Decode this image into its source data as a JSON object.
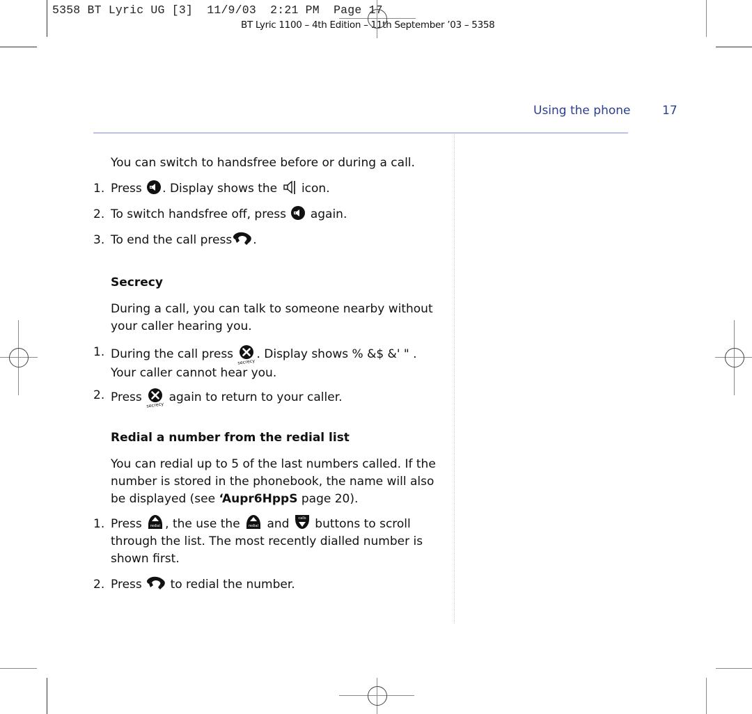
{
  "print_slug": {
    "job": "5358 BT Lyric UG [3]  11/9/03  2:21 PM  Page 17",
    "edition": "BT Lyric 1100 – 4th Edition – 11th September ’03 – 5358"
  },
  "header": {
    "section_title": "Using the phone",
    "page_number": "17",
    "accent_color": "#2a3f8f",
    "rule_color": "#bfc1e0"
  },
  "handsfree": {
    "intro": "You can switch to handsfree before or during a call.",
    "steps": [
      {
        "num": "1.",
        "pre": "Press",
        "mid": ". Display shows the",
        "post": "icon."
      },
      {
        "num": "2.",
        "pre": "To switch handsfree off, press",
        "post": "again."
      },
      {
        "num": "3.",
        "pre": "To end the call press",
        "post": "."
      }
    ]
  },
  "secrecy": {
    "heading": "Secrecy",
    "intro_line1": "During a call, you can talk to someone nearby without",
    "intro_line2": "your caller hearing you.",
    "steps": [
      {
        "num": "1.",
        "pre": "During the call press",
        "post": ". Display shows % &$ &'  \"   .",
        "line2": "Your caller cannot hear you."
      },
      {
        "num": "2.",
        "pre": "Press",
        "post": "again to return to your caller."
      }
    ],
    "icon_label": "secrecy"
  },
  "redial": {
    "heading": "Redial a number from the redial list",
    "intro_line1": "You can redial up to 5 of the last numbers called. If the",
    "intro_line2": "number is stored in the phonebook, the name will also",
    "intro_line3_pre": "be displayed (see ",
    "intro_line3_ref": "‘Aupr6HppS",
    "intro_line3_post": " page 20).",
    "steps": [
      {
        "num": "1.",
        "pre": "Press",
        "mid1": ", the use the",
        "mid2": "and",
        "post": "buttons to scroll",
        "line2": "through the list. The most recently dialled number is",
        "line3": "shown first."
      },
      {
        "num": "2.",
        "pre": "Press",
        "post": "to redial the number."
      }
    ],
    "redial_icon_label": "redial",
    "calls_icon_label": "calls"
  }
}
